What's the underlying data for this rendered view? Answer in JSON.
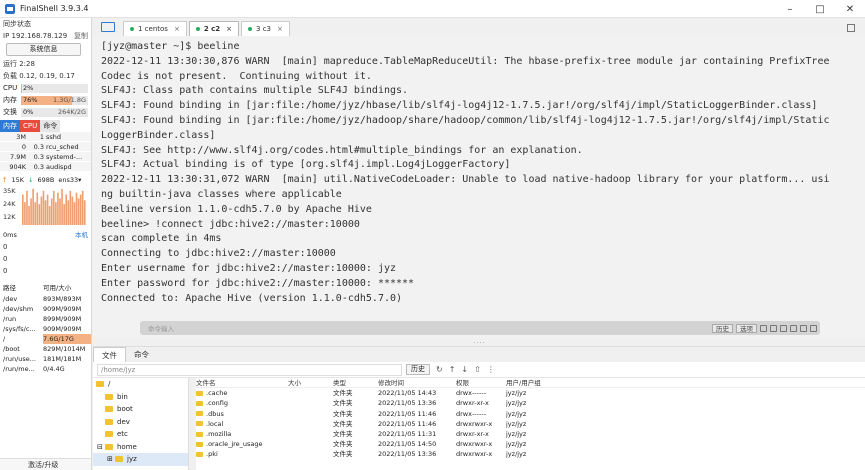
{
  "app": {
    "title": "FinalShell 3.9.3.4"
  },
  "left_panel": {
    "sync_status": "同步状态",
    "ip": "IP 192.168.78.129",
    "copy": "复制",
    "sysinfo_button": "系统信息",
    "uptime": "运行 2:28",
    "load": "负载 0.12, 0.19, 0.17",
    "cpu": {
      "label": "CPU",
      "value": "2%",
      "fraction": 0.02
    },
    "mem": {
      "label": "内存",
      "percent": "76%",
      "detail": "1.3G/1.8G",
      "fraction": 0.76
    },
    "swap": {
      "label": "交换",
      "percent": "0%",
      "detail": "264K/2G",
      "fraction": 0.0
    },
    "proc_tabs": [
      "内存",
      "CPU",
      "命令"
    ],
    "processes": [
      {
        "mem": "3M",
        "cpu": "1",
        "cmd": "sshd"
      },
      {
        "mem": "0",
        "cpu": "0.3",
        "cmd": "rcu_sched"
      },
      {
        "mem": "7.9M",
        "cpu": "0.3",
        "cmd": "systemd-..."
      },
      {
        "mem": "904K",
        "cpu": "0.3",
        "cmd": "audispd"
      }
    ],
    "net": {
      "up": "15K",
      "down": "698B",
      "iface": "ens33",
      "y_labels": [
        "35K",
        "24K",
        "12K"
      ]
    },
    "latency": {
      "label": "0ms",
      "host": "本机",
      "values": [
        "0",
        "0",
        "0"
      ]
    },
    "disk_header": {
      "path": "路径",
      "size": "可用/大小"
    },
    "disks": [
      {
        "path": "/dev",
        "size": "893M/893M"
      },
      {
        "path": "/dev/shm",
        "size": "909M/909M"
      },
      {
        "path": "/run",
        "size": "899M/909M"
      },
      {
        "path": "/sys/fs/c...",
        "size": "909M/909M"
      },
      {
        "path": "/",
        "size": "7.6G/17G"
      },
      {
        "path": "/boot",
        "size": "829M/1014M"
      },
      {
        "path": "/run/use...",
        "size": "181M/181M"
      },
      {
        "path": "/run/me...",
        "size": "0/4.4G"
      }
    ],
    "activate": "激活/升级"
  },
  "tabs": [
    {
      "label": "1 centos",
      "active": false
    },
    {
      "label": "2 c2",
      "active": true
    },
    {
      "label": "3 c3",
      "active": false
    }
  ],
  "terminal": {
    "lines": [
      "[jyz@master ~]$ beeline",
      "2022-12-11 13:30:30,876 WARN  [main] mapreduce.TableMapReduceUtil: The hbase-prefix-tree module jar containing PrefixTree",
      "Codec is not present.  Continuing without it.",
      "SLF4J: Class path contains multiple SLF4J bindings.",
      "SLF4J: Found binding in [jar:file:/home/jyz/hbase/lib/slf4j-log4j12-1.7.5.jar!/org/slf4j/impl/StaticLoggerBinder.class]",
      "SLF4J: Found binding in [jar:file:/home/jyz/hadoop/share/hadoop/common/lib/slf4j-log4j12-1.7.5.jar!/org/slf4j/impl/Static",
      "LoggerBinder.class]",
      "SLF4J: See http://www.slf4j.org/codes.html#multiple_bindings for an explanation.",
      "SLF4J: Actual binding is of type [org.slf4j.impl.Log4jLoggerFactory]",
      "2022-12-11 13:30:31,072 WARN  [main] util.NativeCodeLoader: Unable to load native-hadoop library for your platform... usi",
      "ng builtin-java classes where applicable",
      "Beeline version 1.1.0-cdh5.7.0 by Apache Hive",
      "beeline> !connect jdbc:hive2://master:10000",
      "scan complete in 4ms",
      "Connecting to jdbc:hive2://master:10000",
      "Enter username for jdbc:hive2://master:10000: jyz",
      "Enter password for jdbc:hive2://master:10000: ******",
      "Connected to: Apache Hive (version 1.1.0-cdh5.7.0)"
    ]
  },
  "command_bar": {
    "placeholder": "命令输入",
    "history": "历史",
    "options": "选项"
  },
  "bottom_tabs": [
    "文件",
    "命令"
  ],
  "file_panel": {
    "path": "/home/jyz",
    "history_button": "历史",
    "tree": [
      "/",
      "bin",
      "boot",
      "dev",
      "etc",
      "home",
      "jyz"
    ],
    "columns": [
      "文件名",
      "大小",
      "类型",
      "修改时间",
      "权限",
      "用户/用户组"
    ],
    "files": [
      {
        "name": ".cache",
        "size": "",
        "type": "文件夹",
        "time": "2022/11/05 14:43",
        "perm": "drwx------",
        "user": "jyz/jyz"
      },
      {
        "name": ".config",
        "size": "",
        "type": "文件夹",
        "time": "2022/11/05 13:36",
        "perm": "drwxr-xr-x",
        "user": "jyz/jyz"
      },
      {
        "name": ".dbus",
        "size": "",
        "type": "文件夹",
        "time": "2022/11/05 11:46",
        "perm": "drwx------",
        "user": "jyz/jyz"
      },
      {
        "name": ".local",
        "size": "",
        "type": "文件夹",
        "time": "2022/11/05 11:46",
        "perm": "drwxrwxr-x",
        "user": "jyz/jyz"
      },
      {
        "name": ".mozilla",
        "size": "",
        "type": "文件夹",
        "time": "2022/11/05 11:31",
        "perm": "drwxr-xr-x",
        "user": "jyz/jyz"
      },
      {
        "name": ".oracle_jre_usage",
        "size": "",
        "type": "文件夹",
        "time": "2022/11/05 14:50",
        "perm": "drwxrwxr-x",
        "user": "jyz/jyz"
      },
      {
        "name": ".pki",
        "size": "",
        "type": "文件夹",
        "time": "2022/11/05 13:36",
        "perm": "drwxrwxr-x",
        "user": "jyz/jyz"
      }
    ]
  },
  "colors": {
    "accent": "#2e7bd6",
    "cpu_tab": "#e74c3c",
    "mem_fill": "#f4b183",
    "swap_fill": "#d9d9d9",
    "net_bars": "#f0a070"
  }
}
